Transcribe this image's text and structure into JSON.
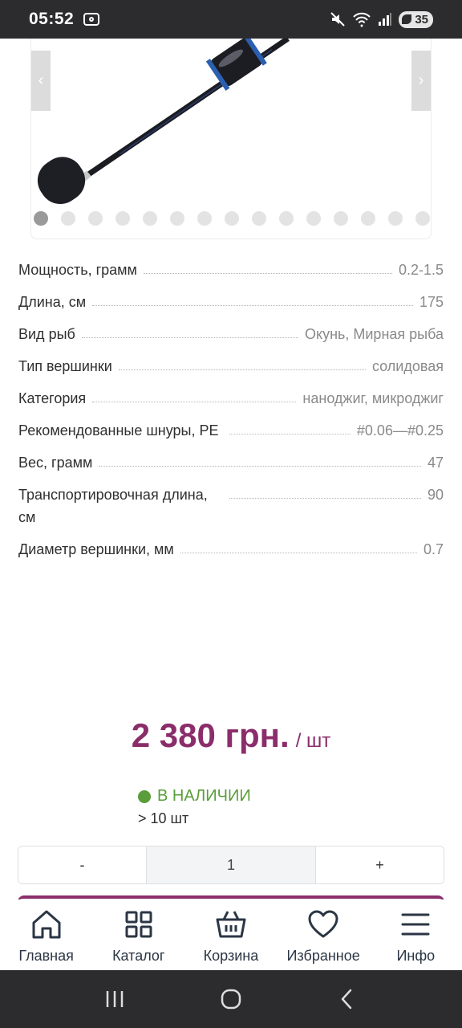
{
  "status_bar": {
    "time": "05:52",
    "battery": "35"
  },
  "carousel": {
    "dot_count": 15,
    "active_index": 0
  },
  "specs": [
    {
      "name": "Мощность, грамм",
      "value": "0.2-1.5"
    },
    {
      "name": "Длина, см",
      "value": "175"
    },
    {
      "name": "Вид рыб",
      "value": "Окунь, Мирная рыба"
    },
    {
      "name": "Тип вершинки",
      "value": "солидовая"
    },
    {
      "name": "Категория",
      "value": "наноджиг, микроджиг"
    },
    {
      "name": "Рекомендованные шнуры, PE",
      "value": "#0.06—#0.25"
    },
    {
      "name": "Вес, грамм",
      "value": "47"
    },
    {
      "name": "Транспортировочная длина, см",
      "value": "90"
    },
    {
      "name": "Диаметр вершинки, мм",
      "value": "0.7"
    }
  ],
  "price": {
    "amount": "2 380 грн.",
    "unit": "/ шт"
  },
  "stock": {
    "status": "В НАЛИЧИИ",
    "count": "> 10 шт"
  },
  "quantity": {
    "minus": "-",
    "value": "1",
    "plus": "+"
  },
  "bottom_nav": [
    {
      "label": "Главная",
      "icon": "home-icon"
    },
    {
      "label": "Каталог",
      "icon": "grid-icon"
    },
    {
      "label": "Корзина",
      "icon": "basket-icon"
    },
    {
      "label": "Избранное",
      "icon": "heart-icon"
    },
    {
      "label": "Инфо",
      "icon": "menu-icon"
    }
  ],
  "colors": {
    "accent": "#8b2d6a",
    "in_stock": "#5a9d3a"
  }
}
